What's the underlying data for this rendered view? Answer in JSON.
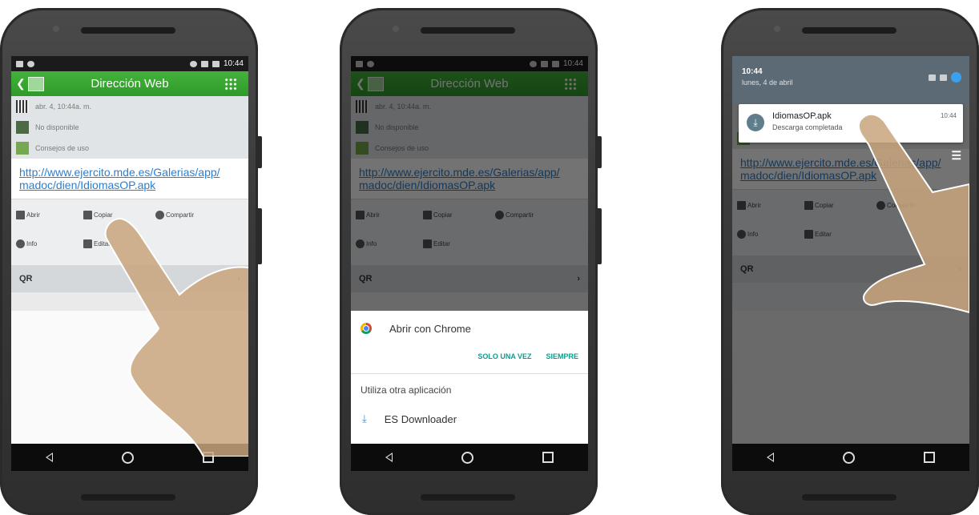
{
  "status_bar": {
    "time": "10:44"
  },
  "app": {
    "title": "Dirección Web",
    "date_text": "abr. 4, 10:44a. m.",
    "location_text": "No disponible",
    "tips_text": "Consejos de uso",
    "url_line1": "http://www.ejercito.mde.es/Galerias/app/",
    "url_line2": "madoc/dien/IdiomasOP.apk",
    "actions": {
      "open": "Abrir",
      "copy": "Copiar",
      "share": "Compartir",
      "info": "Info",
      "edit": "Editar"
    },
    "qr_label": "QR",
    "qr_chevron": "›"
  },
  "chooser": {
    "open_with": "Abrir con Chrome",
    "just_once": "SOLO UNA VEZ",
    "always": "SIEMPRE",
    "other_app": "Utiliza otra aplicación",
    "downloader": "ES Downloader"
  },
  "shade": {
    "time": "10:44",
    "date": "lunes, 4 de abril",
    "notif_title": "IdiomasOP.apk",
    "notif_sub": "Descarga completada",
    "notif_time": "10:44"
  },
  "colors": {
    "appbar_green": "#3aa832",
    "link_blue": "#2b7fd0",
    "accent_teal": "#0f9b8e"
  },
  "icons": [
    "back-arrow-icon",
    "qr-icon",
    "map-icon",
    "tips-icon",
    "grid-menu-icon",
    "open-icon",
    "copy-icon",
    "share-icon",
    "info-icon",
    "edit-icon",
    "chrome-icon",
    "download-icon",
    "nav-back-icon",
    "nav-home-icon",
    "nav-recents-icon"
  ]
}
